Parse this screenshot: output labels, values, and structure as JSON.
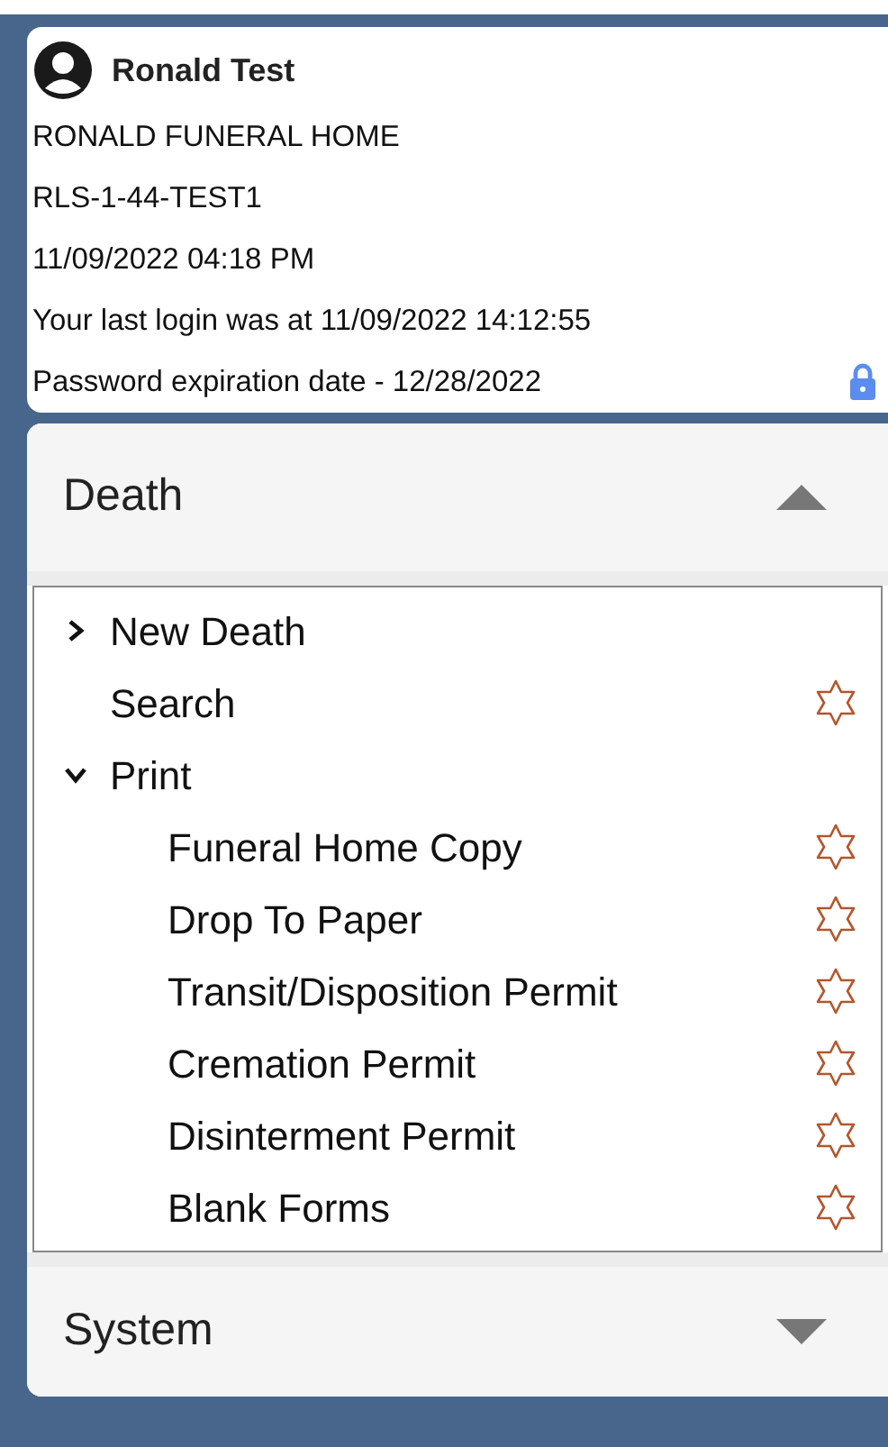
{
  "user": {
    "name": "Ronald Test",
    "lines": [
      "RONALD FUNERAL HOME",
      "RLS-1-44-TEST1",
      "11/09/2022 04:18 PM",
      "Your last login was at 11/09/2022 14:12:55",
      "Password expiration date - 12/28/2022"
    ]
  },
  "sections": [
    {
      "title": "Death",
      "expanded": true,
      "items": [
        {
          "label": "New Death",
          "kind": "folder",
          "expanded": false
        },
        {
          "label": "Search",
          "kind": "link",
          "starred": false
        },
        {
          "label": "Print",
          "kind": "folder",
          "expanded": true,
          "children": [
            {
              "label": "Funeral Home Copy",
              "kind": "link",
              "starred": false
            },
            {
              "label": "Drop To Paper",
              "kind": "link",
              "starred": false
            },
            {
              "label": "Transit/Disposition Permit",
              "kind": "link",
              "starred": false
            },
            {
              "label": "Cremation Permit",
              "kind": "link",
              "starred": false
            },
            {
              "label": "Disinterment Permit",
              "kind": "link",
              "starred": false
            },
            {
              "label": "Blank Forms",
              "kind": "link",
              "starred": false
            }
          ]
        }
      ]
    },
    {
      "title": "System",
      "expanded": false
    }
  ]
}
